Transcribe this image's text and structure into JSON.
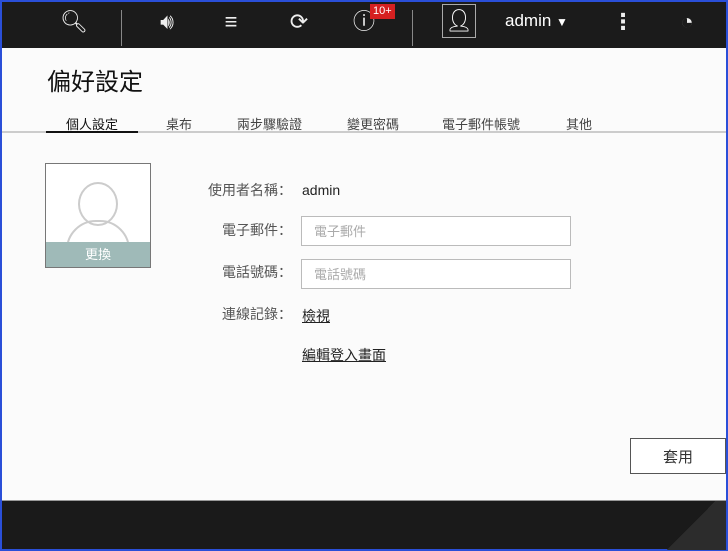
{
  "topbar": {
    "icons": [
      "search-icon",
      "volume-icon",
      "stack-icon",
      "sync-icon",
      "info-icon",
      "user-icon",
      "more-icon",
      "dashboard-icon"
    ],
    "notification_badge": "10+",
    "username": "admin",
    "dropdown_caret": "▼"
  },
  "page": {
    "title": "偏好設定"
  },
  "tabs": [
    {
      "label": "個人設定",
      "active": true
    },
    {
      "label": "桌布"
    },
    {
      "label": "兩步驟驗證"
    },
    {
      "label": "變更密碼"
    },
    {
      "label": "電子郵件帳號"
    },
    {
      "label": "其他"
    }
  ],
  "profile": {
    "change_photo_label": "更換",
    "username_label": "使用者名稱：",
    "username_value": "admin",
    "email_label": "電子郵件：",
    "email_placeholder": "電子郵件",
    "email_value": "",
    "phone_label": "電話號碼：",
    "phone_placeholder": "電話號碼",
    "phone_value": "",
    "log_label": "連線記錄：",
    "log_link": "檢視",
    "edit_login_link": "編輯登入畫面"
  },
  "actions": {
    "apply_label": "套用"
  }
}
